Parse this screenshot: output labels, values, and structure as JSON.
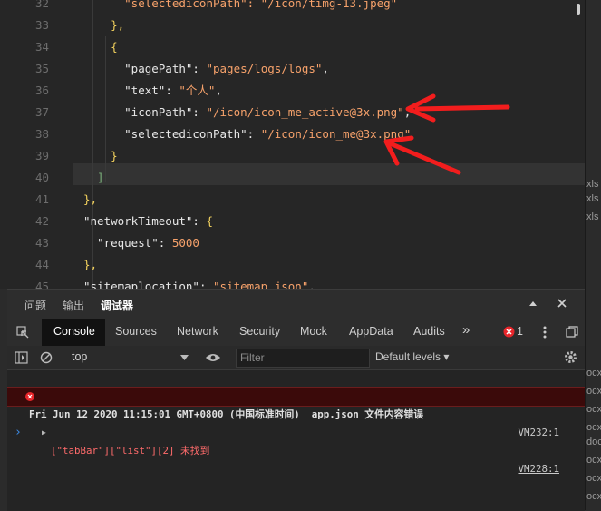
{
  "editor": {
    "lines": [
      {
        "num": "32",
        "tokens": [
          {
            "t": "      \"selectediconPath\": \"/icon/timg-13.jpeg\"",
            "c": "s"
          }
        ]
      },
      {
        "num": "33",
        "tokens": [
          {
            "t": "    },",
            "c": "y"
          }
        ]
      },
      {
        "num": "34",
        "tokens": [
          {
            "t": "    {",
            "c": "y"
          }
        ]
      },
      {
        "num": "35",
        "tokens": [
          {
            "t": "      \"pagePath\"",
            "c": "k"
          },
          {
            "t": ": ",
            "c": "p"
          },
          {
            "t": "\"pages/logs/logs\"",
            "c": "s"
          },
          {
            "t": ",",
            "c": "p"
          }
        ]
      },
      {
        "num": "36",
        "tokens": [
          {
            "t": "      \"text\"",
            "c": "k"
          },
          {
            "t": ": ",
            "c": "p"
          },
          {
            "t": "\"个人\"",
            "c": "s"
          },
          {
            "t": ",",
            "c": "p"
          }
        ]
      },
      {
        "num": "37",
        "tokens": [
          {
            "t": "      \"iconPath\"",
            "c": "k"
          },
          {
            "t": ": ",
            "c": "p"
          },
          {
            "t": "\"/icon/icon_me_active@3x.png\"",
            "c": "s"
          },
          {
            "t": ",",
            "c": "p"
          }
        ]
      },
      {
        "num": "38",
        "tokens": [
          {
            "t": "      \"selectediconPath\"",
            "c": "k"
          },
          {
            "t": ": ",
            "c": "p"
          },
          {
            "t": "\"/icon/icon_me@3x.png\"",
            "c": "s"
          }
        ]
      },
      {
        "num": "39",
        "tokens": [
          {
            "t": "    }",
            "c": "y"
          }
        ]
      },
      {
        "num": "40",
        "tokens": [
          {
            "t": "  ]",
            "c": "g"
          }
        ]
      },
      {
        "num": "41",
        "tokens": [
          {
            "t": "},",
            "c": "y"
          }
        ]
      },
      {
        "num": "42",
        "tokens": [
          {
            "t": "\"networkTimeout\"",
            "c": "k"
          },
          {
            "t": ": ",
            "c": "p"
          },
          {
            "t": "{",
            "c": "y"
          }
        ]
      },
      {
        "num": "43",
        "tokens": [
          {
            "t": "  \"request\"",
            "c": "k"
          },
          {
            "t": ": ",
            "c": "p"
          },
          {
            "t": "5000",
            "c": "n"
          }
        ]
      },
      {
        "num": "44",
        "tokens": [
          {
            "t": "},",
            "c": "y"
          }
        ]
      },
      {
        "num": "45",
        "tokens": [
          {
            "t": "\"sitemaplocation\"",
            "c": "k"
          },
          {
            "t": ": ",
            "c": "p"
          },
          {
            "t": "\"sitemap.json\"",
            "c": "s"
          },
          {
            "t": ",",
            "c": "p"
          }
        ]
      }
    ]
  },
  "right_strip": [
    "xls",
    "xls",
    "xls",
    "ocx",
    "ocx",
    "ocx",
    "ocx",
    "doc",
    "ocx",
    "ocx",
    "ocx"
  ],
  "panel": {
    "top_tabs": [
      "问题",
      "输出",
      "调试器"
    ],
    "devtools_tabs": [
      "Console",
      "Sources",
      "Network",
      "Security",
      "Mock",
      "AppData",
      "Audits"
    ],
    "more_label": "»",
    "error_count": "1",
    "context": "top",
    "filter_placeholder": "Filter",
    "levels": "Default levels"
  },
  "console": {
    "group_text": "Fri Jun 12 2020 11:15:01 GMT+0800 (中国标准时间)  app.json 文件内容错误",
    "group_link": "VM232:1",
    "error_text": "[\"tabBar\"][\"list\"][2] 未找到",
    "error_link": "VM228:1",
    "prompt": "›"
  },
  "colors": {
    "error": "#ff3b3b",
    "accent": "#3c8ce7"
  }
}
